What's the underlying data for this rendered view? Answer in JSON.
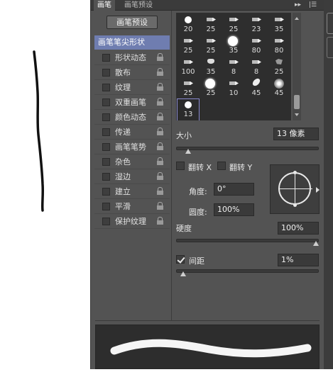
{
  "tabs": [
    {
      "label": "画笔"
    },
    {
      "label": "画笔预设"
    }
  ],
  "panel_menu": {
    "collapse_icon": "double-chevron-right-icon",
    "menu_icon": "panel-menu-icon"
  },
  "preset_button": "画笔预设",
  "brush_settings": [
    {
      "label": "画笔笔尖形状",
      "selected": true
    },
    {
      "label": "形状动态",
      "checked": false
    },
    {
      "label": "散布",
      "checked": false
    },
    {
      "label": "纹理",
      "checked": false
    },
    {
      "label": "双重画笔",
      "checked": false
    },
    {
      "label": "颜色动态",
      "checked": false
    },
    {
      "label": "传递",
      "checked": false
    },
    {
      "label": "画笔笔势",
      "checked": false
    },
    {
      "label": "杂色",
      "checked": false
    },
    {
      "label": "湿边",
      "checked": false
    },
    {
      "label": "建立",
      "checked": false
    },
    {
      "label": "平滑",
      "checked": false
    },
    {
      "label": "保护纹理",
      "checked": false
    }
  ],
  "brush_tips": [
    [
      {
        "icon": "dot",
        "size": "20"
      },
      {
        "icon": "arrow",
        "size": "25"
      },
      {
        "icon": "arrow",
        "size": "25"
      },
      {
        "icon": "arrow",
        "size": "23"
      },
      {
        "icon": "arrow",
        "size": "35"
      }
    ],
    [
      {
        "icon": "arrow",
        "size": "25"
      },
      {
        "icon": "arrow",
        "size": "25"
      },
      {
        "icon": "big",
        "size": "35"
      },
      {
        "icon": "arrow",
        "size": "80"
      },
      {
        "icon": "arrow",
        "size": "80"
      }
    ],
    [
      {
        "icon": "arrow",
        "size": "100"
      },
      {
        "icon": "blob",
        "size": "35"
      },
      {
        "icon": "arrow",
        "size": "8"
      },
      {
        "icon": "arrow",
        "size": "8"
      },
      {
        "icon": "splat",
        "size": "25"
      }
    ],
    [
      {
        "icon": "arrow",
        "size": "25"
      },
      {
        "icon": "big",
        "size": "25"
      },
      {
        "icon": "arrow",
        "size": "10"
      },
      {
        "icon": "leaf",
        "size": "45"
      },
      {
        "icon": "soft",
        "size": "45"
      }
    ],
    [
      {
        "icon": "dot",
        "size": "13",
        "selected": true
      }
    ]
  ],
  "size": {
    "label": "大小",
    "value": "13 像素",
    "level": 0.04
  },
  "flip_x": {
    "label": "翻转 X",
    "checked": false
  },
  "flip_y": {
    "label": "翻转 Y",
    "checked": false
  },
  "angle": {
    "label": "角度:",
    "value": "0°"
  },
  "roundness": {
    "label": "圆度:",
    "value": "100%"
  },
  "hardness": {
    "label": "硬度",
    "value": "100%",
    "level": 1.0
  },
  "spacing": {
    "label": "间距",
    "value": "1%",
    "checked": true,
    "level": 0.0
  }
}
